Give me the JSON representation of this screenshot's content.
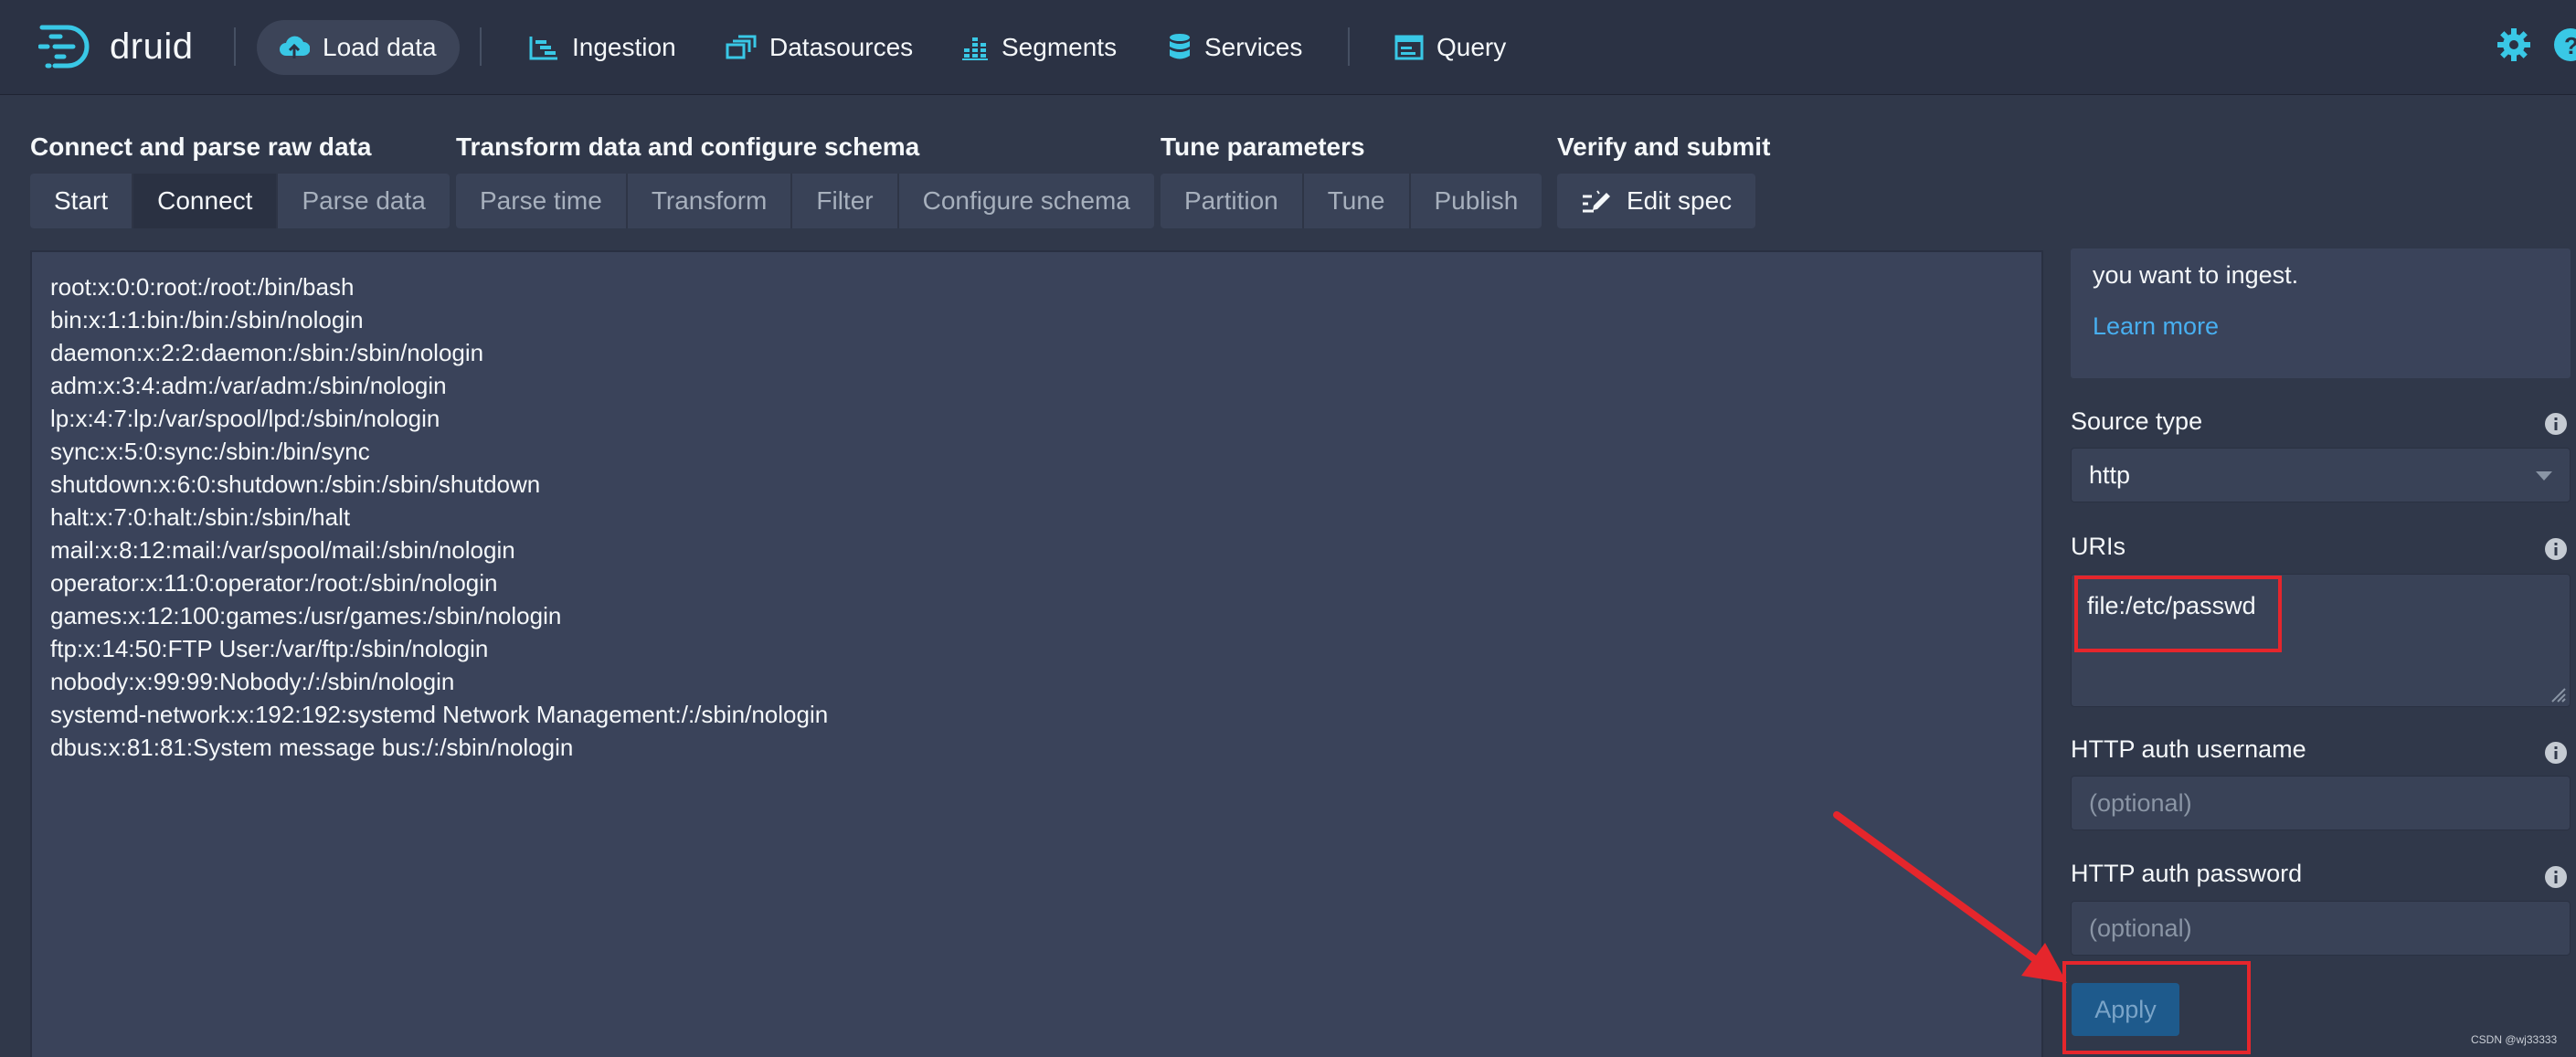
{
  "brand": {
    "name": "druid"
  },
  "nav": {
    "items": [
      {
        "label": "Load data",
        "icon": "cloud-upload-icon",
        "active": true
      },
      {
        "label": "Ingestion",
        "icon": "gantt-chart-icon"
      },
      {
        "label": "Datasources",
        "icon": "multi-select-icon"
      },
      {
        "label": "Segments",
        "icon": "stacked-chart-icon"
      },
      {
        "label": "Services",
        "icon": "database-icon"
      },
      {
        "label": "Query",
        "icon": "application-icon"
      }
    ],
    "right_icons": [
      "gear-icon",
      "help-icon"
    ]
  },
  "steps": {
    "groups": [
      {
        "title": "Connect and parse raw data",
        "items": [
          "Start",
          "Connect",
          "Parse data"
        ]
      },
      {
        "title": "Transform data and configure schema",
        "items": [
          "Parse time",
          "Transform",
          "Filter",
          "Configure schema"
        ]
      },
      {
        "title": "Tune parameters",
        "items": [
          "Partition",
          "Tune",
          "Publish"
        ]
      },
      {
        "title": "Verify and submit",
        "items": [
          "Edit spec"
        ]
      }
    ],
    "current": "Connect"
  },
  "preview": {
    "lines": [
      "root:x:0:0:root:/root:/bin/bash",
      "bin:x:1:1:bin:/bin:/sbin/nologin",
      "daemon:x:2:2:daemon:/sbin:/sbin/nologin",
      "adm:x:3:4:adm:/var/adm:/sbin/nologin",
      "lp:x:4:7:lp:/var/spool/lpd:/sbin/nologin",
      "sync:x:5:0:sync:/sbin:/bin/sync",
      "shutdown:x:6:0:shutdown:/sbin:/sbin/shutdown",
      "halt:x:7:0:halt:/sbin:/sbin/halt",
      "mail:x:8:12:mail:/var/spool/mail:/sbin/nologin",
      "operator:x:11:0:operator:/root:/sbin/nologin",
      "games:x:12:100:games:/usr/games:/sbin/nologin",
      "ftp:x:14:50:FTP User:/var/ftp:/sbin/nologin",
      "nobody:x:99:99:Nobody:/:/sbin/nologin",
      "systemd-network:x:192:192:systemd Network Management:/:/sbin/nologin",
      "dbus:x:81:81:System message bus:/:/sbin/nologin"
    ]
  },
  "panel": {
    "info_partial": "you want to ingest.",
    "learn_more": "Learn more",
    "source_type_label": "Source type",
    "source_type_value": "http",
    "uris_label": "URIs",
    "uris_value": "file:/etc/passwd",
    "auth_username_label": "HTTP auth username",
    "auth_username_placeholder": "(optional)",
    "auth_password_label": "HTTP auth password",
    "auth_password_placeholder": "(optional)",
    "apply_label": "Apply"
  },
  "annotations": {
    "highlight_color": "#e5262c"
  },
  "watermark": "CSDN @wj33333",
  "colors": {
    "navbar_bg": "#2b3244",
    "page_bg": "#30384a",
    "accent_cyan": "#39c8e6",
    "link_blue": "#48aff0",
    "apply_bg": "#1e5a8c"
  }
}
